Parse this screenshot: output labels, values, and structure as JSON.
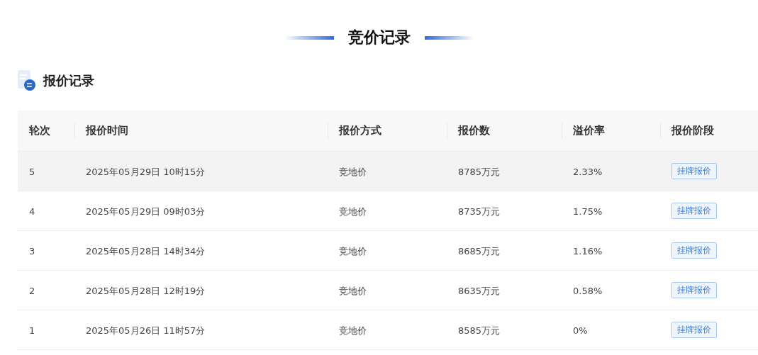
{
  "page_title": "竞价记录",
  "section": {
    "title": "报价记录"
  },
  "table": {
    "columns": [
      "轮次",
      "报价时间",
      "报价方式",
      "报价数",
      "溢价率",
      "报价阶段"
    ],
    "rows": [
      {
        "round": "5",
        "time": "2025年05月29日 10时15分",
        "method": "竞地价",
        "amount": "8785万元",
        "premium": "2.33%",
        "stage": "挂牌报价",
        "highlighted": true
      },
      {
        "round": "4",
        "time": "2025年05月29日 09时03分",
        "method": "竞地价",
        "amount": "8735万元",
        "premium": "1.75%",
        "stage": "挂牌报价",
        "highlighted": false
      },
      {
        "round": "3",
        "time": "2025年05月28日 14时34分",
        "method": "竞地价",
        "amount": "8685万元",
        "premium": "1.16%",
        "stage": "挂牌报价",
        "highlighted": false
      },
      {
        "round": "2",
        "time": "2025年05月28日 12时19分",
        "method": "竞地价",
        "amount": "8635万元",
        "premium": "0.58%",
        "stage": "挂牌报价",
        "highlighted": false
      },
      {
        "round": "1",
        "time": "2025年05月26日 11时57分",
        "method": "竞地价",
        "amount": "8585万元",
        "premium": "0%",
        "stage": "挂牌报价",
        "highlighted": false
      }
    ]
  }
}
